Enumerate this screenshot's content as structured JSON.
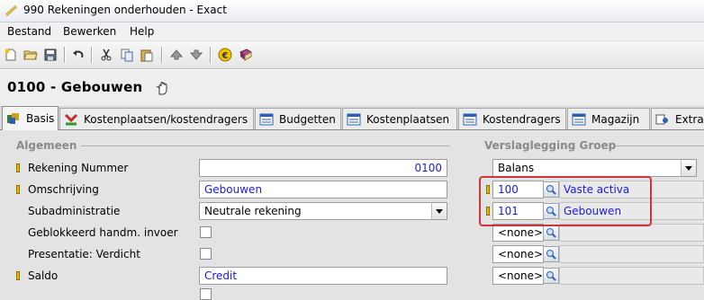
{
  "window": {
    "title": "990 Rekeningen onderhouden - Exact"
  },
  "menu": [
    {
      "label": "Bestand"
    },
    {
      "label": "Bewerken"
    },
    {
      "label": "Help"
    }
  ],
  "toolbar": {
    "icons": [
      "new-icon",
      "open-icon",
      "save-icon",
      "undo-icon",
      "cut-icon",
      "copy-icon",
      "paste-icon",
      "up-icon",
      "down-icon",
      "euro-icon",
      "book-icon"
    ]
  },
  "header": {
    "title": "0100 - Gebouwen"
  },
  "tabs": [
    {
      "label": "Basis",
      "active": true
    },
    {
      "label": "Kostenplaatsen/kostendragers"
    },
    {
      "label": "Budgetten"
    },
    {
      "label": "Kostenplaatsen"
    },
    {
      "label": "Kostendragers"
    },
    {
      "label": "Magazijn"
    },
    {
      "label": "Extra"
    }
  ],
  "left": {
    "section": "Algemeen",
    "fields": {
      "rekening_nummer": {
        "label": "Rekening Nummer",
        "value": "0100"
      },
      "omschrijving": {
        "label": "Omschrijving",
        "value": "Gebouwen"
      },
      "subadministratie": {
        "label": "Subadministratie",
        "value": "Neutrale rekening"
      },
      "geblokkeerd": {
        "label": "Geblokkeerd handm. invoer",
        "checked": false
      },
      "presentatie": {
        "label": "Presentatie: Verdicht",
        "checked": false
      },
      "saldo": {
        "label": "Saldo",
        "value": "Credit"
      }
    }
  },
  "right": {
    "section": "Verslaglegging Groep",
    "type": "Balans",
    "groups": [
      {
        "code": "100",
        "description": "Vaste activa"
      },
      {
        "code": "101",
        "description": "Gebouwen"
      },
      {
        "code": "<none>",
        "description": ""
      },
      {
        "code": "<none>",
        "description": ""
      },
      {
        "code": "<none>",
        "description": ""
      }
    ]
  },
  "colors": {
    "highlight_box": "#d0343a",
    "value_text": "#1a1ae0"
  }
}
